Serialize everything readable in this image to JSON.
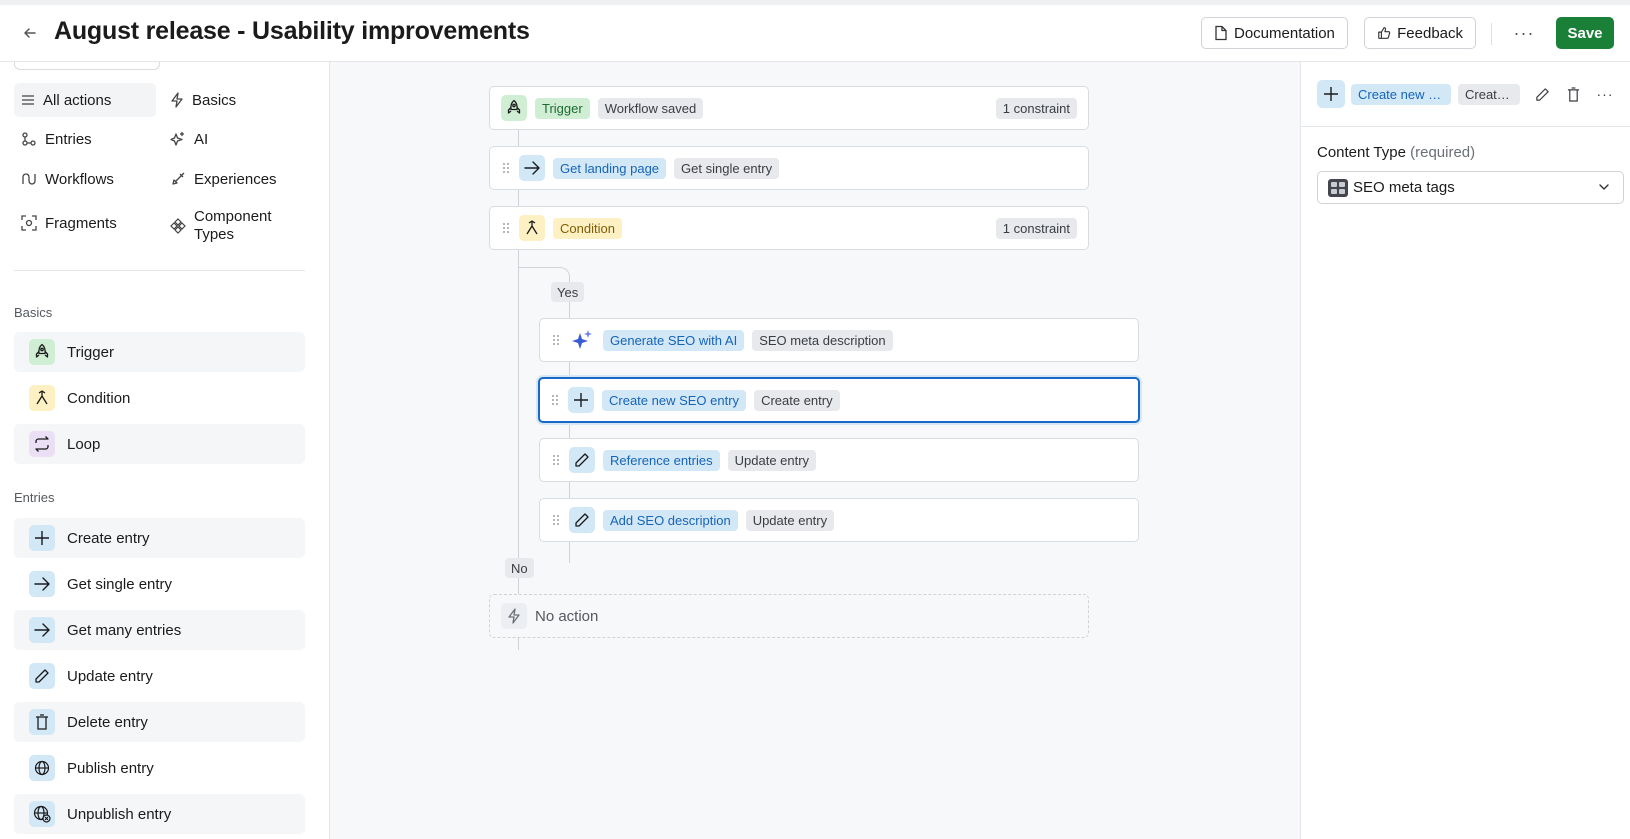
{
  "header": {
    "title": "August release - Usability improvements",
    "documentation_label": "Documentation",
    "feedback_label": "Feedback",
    "more_label": "···",
    "save_label": "Save"
  },
  "sidebar": {
    "categories": [
      {
        "label": "All actions",
        "icon": "list-icon",
        "active": true
      },
      {
        "label": "Basics",
        "icon": "bolt-icon"
      },
      {
        "label": "Entries",
        "icon": "entries-icon"
      },
      {
        "label": "AI",
        "icon": "ai-sparkle-icon"
      },
      {
        "label": "Workflows",
        "icon": "workflow-icon"
      },
      {
        "label": "Experiences",
        "icon": "experiences-icon"
      },
      {
        "label": "Fragments",
        "icon": "fragments-icon"
      },
      {
        "label": "Component Types",
        "icon": "component-icon"
      }
    ],
    "sections": [
      {
        "title": "Basics",
        "items": [
          {
            "label": "Trigger",
            "icon": "rocket-icon",
            "color": "#cfeed4"
          },
          {
            "label": "Condition",
            "icon": "branch-icon",
            "color": "#fdf0c2"
          },
          {
            "label": "Loop",
            "icon": "loop-icon",
            "color": "#ebdff5"
          }
        ]
      },
      {
        "title": "Entries",
        "items": [
          {
            "label": "Create entry",
            "icon": "plus-icon",
            "color": "#d3e8f7"
          },
          {
            "label": "Get single entry",
            "icon": "arrow-right-icon",
            "color": "#d3e8f7"
          },
          {
            "label": "Get many entries",
            "icon": "arrow-right-icon",
            "color": "#d3e8f7"
          },
          {
            "label": "Update entry",
            "icon": "pencil-icon",
            "color": "#d3e8f7"
          },
          {
            "label": "Delete entry",
            "icon": "trash-icon",
            "color": "#d3e8f7"
          },
          {
            "label": "Publish entry",
            "icon": "globe-icon",
            "color": "#d3e8f7"
          },
          {
            "label": "Unpublish entry",
            "icon": "globe-off-icon",
            "color": "#d3e8f7"
          }
        ]
      }
    ]
  },
  "workflow": {
    "trigger": {
      "label": "Trigger",
      "detail": "Workflow saved",
      "badge": "1 constraint"
    },
    "get_landing": {
      "label": "Get landing page",
      "detail": "Get single entry"
    },
    "condition": {
      "label": "Condition",
      "badge": "1 constraint"
    },
    "yes_label": "Yes",
    "no_label": "No",
    "yes_steps": [
      {
        "label": "Generate SEO with AI",
        "detail": "SEO meta description",
        "icon": "ai-sparkle-icon"
      },
      {
        "label": "Create new SEO entry",
        "detail": "Create entry",
        "icon": "plus-icon",
        "selected": true
      },
      {
        "label": "Reference entries",
        "detail": "Update entry",
        "icon": "pencil-icon"
      },
      {
        "label": "Add SEO description",
        "detail": "Update entry",
        "icon": "pencil-icon"
      }
    ],
    "no_action_label": "No action"
  },
  "details_panel": {
    "step_label": "Create new S...",
    "step_detail": "Create...",
    "field_label": "Content Type",
    "field_required": "(required)",
    "content_type_value": "SEO meta tags"
  },
  "colors": {
    "accent": "#1669c7",
    "save": "#1a7f37",
    "trigger": "#cfeed4",
    "condition": "#fdf0c2",
    "entry": "#d3e8f7"
  }
}
